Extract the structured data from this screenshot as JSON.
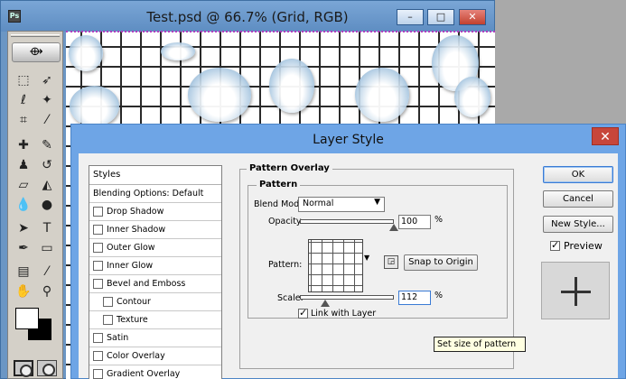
{
  "document_window": {
    "title": "Test.psd @ 66.7% (Grid, RGB)",
    "app_icon": "Ps",
    "controls": {
      "minimize": "–",
      "maximize": "□",
      "close": "✕"
    }
  },
  "toolbox": {
    "tools": [
      "marquee-tool",
      "move-tool",
      "lasso-tool",
      "magic-wand-tool",
      "crop-tool",
      "slice-tool",
      "healing-brush-tool",
      "brush-tool",
      "clone-stamp-tool",
      "history-brush-tool",
      "eraser-tool",
      "paint-bucket-tool",
      "blur-tool",
      "dodge-tool",
      "path-selection-tool",
      "type-tool",
      "pen-tool",
      "rectangle-tool",
      "notes-tool",
      "eyedropper-tool",
      "hand-tool",
      "zoom-tool"
    ],
    "foreground_color": "#ffffff",
    "background_color": "#000000"
  },
  "dialog": {
    "title": "Layer Style",
    "close": "✕",
    "styles_header": "Styles",
    "styles": [
      {
        "label": "Blending Options: Default",
        "checkbox": false
      },
      {
        "label": "Drop Shadow",
        "checkbox": true,
        "checked": false
      },
      {
        "label": "Inner Shadow",
        "checkbox": true,
        "checked": false
      },
      {
        "label": "Outer Glow",
        "checkbox": true,
        "checked": false
      },
      {
        "label": "Inner Glow",
        "checkbox": true,
        "checked": false
      },
      {
        "label": "Bevel and Emboss",
        "checkbox": true,
        "checked": false
      },
      {
        "label": "Contour",
        "checkbox": true,
        "checked": false,
        "indent": true
      },
      {
        "label": "Texture",
        "checkbox": true,
        "checked": false,
        "indent": true
      },
      {
        "label": "Satin",
        "checkbox": true,
        "checked": false
      },
      {
        "label": "Color Overlay",
        "checkbox": true,
        "checked": false
      },
      {
        "label": "Gradient Overlay",
        "checkbox": true,
        "checked": false
      }
    ],
    "pattern_overlay": {
      "section_title": "Pattern Overlay",
      "group_title": "Pattern",
      "blend_mode_label": "Blend Mode:",
      "blend_mode_value": "Normal",
      "opacity_label": "Opacity:",
      "opacity_value": "100",
      "opacity_unit": "%",
      "opacity_fraction": 1.0,
      "pattern_label": "Pattern:",
      "snap_button": "Snap to Origin",
      "scale_label": "Scale:",
      "scale_value": "112",
      "scale_unit": "%",
      "scale_fraction": 0.27,
      "link_label": "Link with Layer",
      "link_checked": true
    },
    "tooltip": "Set size of pattern",
    "buttons": {
      "ok": "OK",
      "cancel": "Cancel",
      "new_style": "New Style..."
    },
    "preview_label": "Preview",
    "preview_checked": true
  }
}
